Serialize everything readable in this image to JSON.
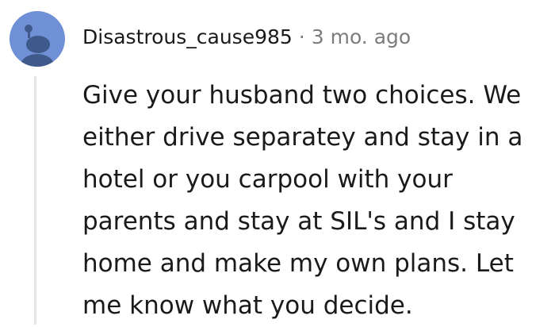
{
  "comment": {
    "username": "Disastrous_cause985",
    "separator": "·",
    "timestamp": "3 mo. ago",
    "avatar_icon": "snoo-avatar-icon",
    "body_lines": [
      "Give your husband two choices. We",
      "either drive separatey and stay in a",
      "hotel or you carpool with your",
      "parents and stay at SIL's and I stay",
      "home and make my own plans. Let",
      "me know what you decide."
    ]
  },
  "colors": {
    "avatar_bg": "#6f8fd6",
    "avatar_figure": "#3f5a8a",
    "meta_text": "#7c7c7c",
    "thread_line": "#e6e6e6"
  }
}
